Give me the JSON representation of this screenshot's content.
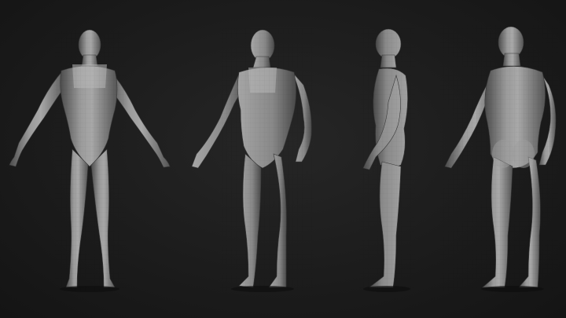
{
  "scene": {
    "description_visible_text": "",
    "background_color": "#1c1c1c",
    "skin_color": "#8c8c8c",
    "skin_highlight": "#b4b4b4",
    "skin_shadow": "#4a4a4a",
    "views": [
      {
        "name": "front"
      },
      {
        "name": "three-quarter"
      },
      {
        "name": "side"
      },
      {
        "name": "back"
      }
    ]
  }
}
